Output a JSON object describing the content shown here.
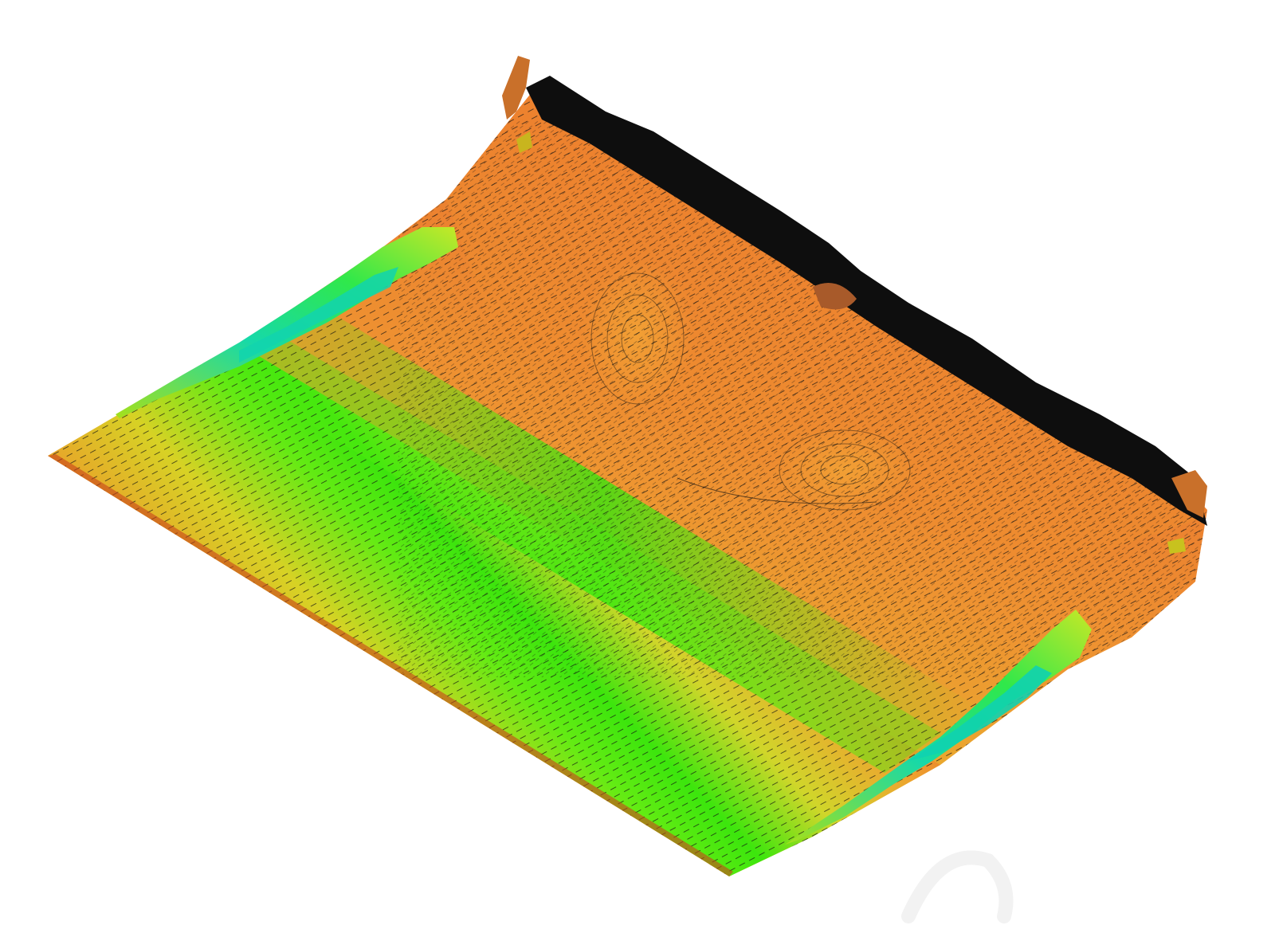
{
  "visualization": {
    "kind": "3d-surface-with-velocity-vector-field",
    "colormap": [
      "#e8461f",
      "#f08a2a",
      "#e9c52a",
      "#c9e11c",
      "#33e80b",
      "#12d8b3"
    ],
    "vector_color": "#111111",
    "background_color": "#ffffff",
    "vortex_count": 2,
    "ridge_count": 2
  }
}
